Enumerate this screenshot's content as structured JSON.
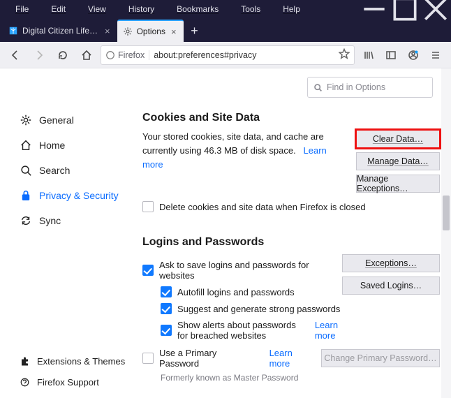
{
  "menubar": {
    "items": [
      "File",
      "Edit",
      "View",
      "History",
      "Bookmarks",
      "Tools",
      "Help"
    ]
  },
  "tabs": [
    {
      "label": "Digital Citizen Life in a digital w",
      "active": false
    },
    {
      "label": "Options",
      "active": true
    }
  ],
  "urlbar": {
    "identity": "Firefox",
    "url": "about:preferences#privacy"
  },
  "find": {
    "placeholder": "Find in Options"
  },
  "sidebar": {
    "items": [
      {
        "label": "General"
      },
      {
        "label": "Home"
      },
      {
        "label": "Search"
      },
      {
        "label": "Privacy & Security",
        "active": true
      },
      {
        "label": "Sync"
      }
    ],
    "footer": {
      "extensions": "Extensions & Themes",
      "support": "Firefox Support"
    }
  },
  "cookies": {
    "heading": "Cookies and Site Data",
    "text_prefix": "Your stored cookies, site data, and cache are currently using ",
    "size": "46.3 MB",
    "size_suffix": " of disk space.",
    "learn_more": "Learn more",
    "clear_data": "Clear Data…",
    "manage_data": "Manage Data…",
    "manage_exceptions": "Manage Exceptions…",
    "delete_on_close": "Delete cookies and site data when Firefox is closed"
  },
  "logins": {
    "heading": "Logins and Passwords",
    "ask_save": "Ask to save logins and passwords for websites",
    "autofill": "Autofill logins and passwords",
    "suggest": "Suggest and generate strong passwords",
    "alerts": "Show alerts about passwords for breached websites",
    "learn_more": "Learn more",
    "exceptions": "Exceptions…",
    "saved_logins": "Saved Logins…",
    "use_primary": "Use a Primary Password",
    "learn_more2": "Learn more",
    "change_primary": "Change Primary Password…",
    "note": "Formerly known as Master Password"
  }
}
